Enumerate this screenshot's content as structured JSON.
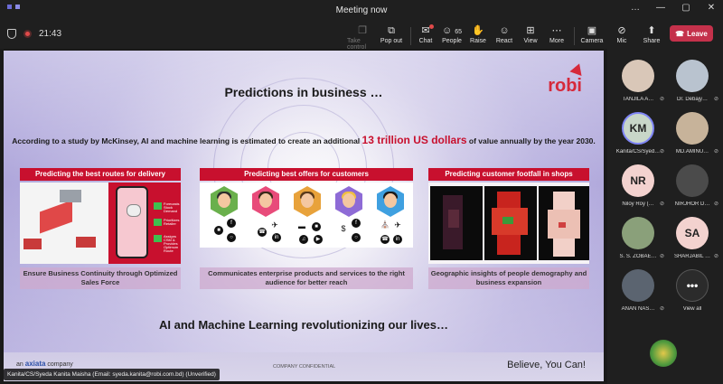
{
  "window": {
    "title": "Meeting now",
    "controls": [
      "…",
      "—",
      "▢",
      "✕"
    ]
  },
  "toolbar": {
    "timer": "21:43",
    "items": [
      {
        "label": "Take control",
        "icon": "take-control-icon",
        "glyph": "❐"
      },
      {
        "label": "Pop out",
        "icon": "pop-out-icon",
        "glyph": "⧉"
      },
      {
        "label": "Chat",
        "icon": "chat-icon",
        "glyph": "✉"
      },
      {
        "label": "People",
        "icon": "people-icon",
        "glyph": "☺",
        "count": "65"
      },
      {
        "label": "Raise",
        "icon": "raise-hand-icon",
        "glyph": "✋"
      },
      {
        "label": "React",
        "icon": "react-icon",
        "glyph": "☺"
      },
      {
        "label": "View",
        "icon": "view-icon",
        "glyph": "⊞"
      },
      {
        "label": "More",
        "icon": "more-icon",
        "glyph": "⋯"
      },
      {
        "label": "Camera",
        "icon": "camera-off-icon",
        "glyph": "▣"
      },
      {
        "label": "Mic",
        "icon": "mic-off-icon",
        "glyph": "⊘"
      },
      {
        "label": "Share",
        "icon": "share-icon",
        "glyph": "⬆"
      }
    ],
    "leave_label": "Leave"
  },
  "slide": {
    "title": "Predictions in business …",
    "logo": "robi",
    "stat_pre": "According to a study by McKinsey, AI and machine learning is estimated to create an additional ",
    "stat_highlight": "13 trillion US dollars",
    "stat_post": " of value annually by the year 2030.",
    "cards": [
      {
        "heading": "Predicting the best routes for delivery",
        "caption": "Ensure Business Continuity through Optimized Sales Force",
        "checks": [
          "Forecasts Stock Demand",
          "Prioritizes Retailer",
          "Assigns CSM & Provides Optimum Route"
        ]
      },
      {
        "heading": "Predicting best offers for customers",
        "caption": "Communicates enterprise products and services to the right audience for better reach"
      },
      {
        "heading": "Predicting customer footfall in shops",
        "caption": "Geographic insights of people demography and business expansion"
      }
    ],
    "bottom_line": "AI and Machine Learning revolutionizing our lives…",
    "footer": {
      "company_prefix": "an",
      "company": "axiata",
      "company_suffix": "company",
      "confidential": "COMPANY CONFIDENTIAL",
      "tagline": "Believe, You Can!"
    }
  },
  "presenter_label": "Kanita/CS/Syeda Kanita Maisha (Email: syeda.kanita@robi.com.bd) (Unverified)",
  "participants": [
    {
      "name": "TANJILA A…",
      "initials": "",
      "color": "#d9c7b8",
      "muted": true
    },
    {
      "name": "Dr. Debajy…",
      "initials": "",
      "color": "#b9c3cf",
      "muted": true
    },
    {
      "name": "Kanita/CS/Syed…",
      "initials": "KM",
      "color": "#c8d6c8",
      "muted": true,
      "active": true
    },
    {
      "name": "MD.AMINU…",
      "initials": "",
      "color": "#c7b39a",
      "muted": true
    },
    {
      "name": "Niloy Roy (…",
      "initials": "NR",
      "color": "#f3d2cf",
      "muted": true
    },
    {
      "name": "NIRJHOR D…",
      "initials": "",
      "color": "#4b4b4b",
      "muted": true
    },
    {
      "name": "S. S. ZOBAE…",
      "initials": "",
      "color": "#8aa07a",
      "muted": true
    },
    {
      "name": "SHARJABIL …",
      "initials": "SA",
      "color": "#f3d2cf",
      "muted": true
    },
    {
      "name": "ANAN NAS…",
      "initials": "",
      "color": "#5b6470",
      "muted": true
    },
    {
      "name": "View all",
      "initials": "•••",
      "color": "#2b2b2b",
      "muted": false
    }
  ]
}
